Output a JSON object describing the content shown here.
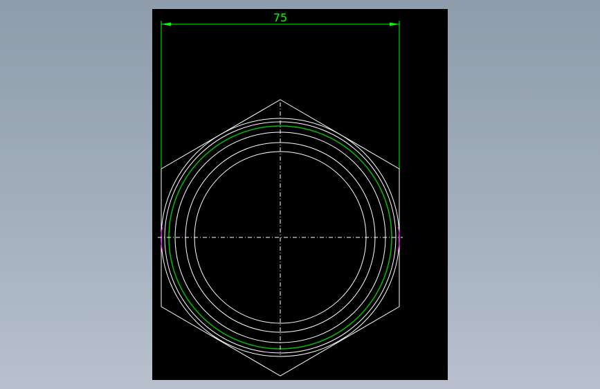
{
  "drawing": {
    "background_color": "#000000",
    "outline_color": "#ffffff",
    "dimension_color": "#00ff00",
    "thread_color": "#00c000",
    "centerline_color": "#ffffff",
    "accent_color": "#ff00ff",
    "dimension": {
      "label": "75"
    }
  }
}
